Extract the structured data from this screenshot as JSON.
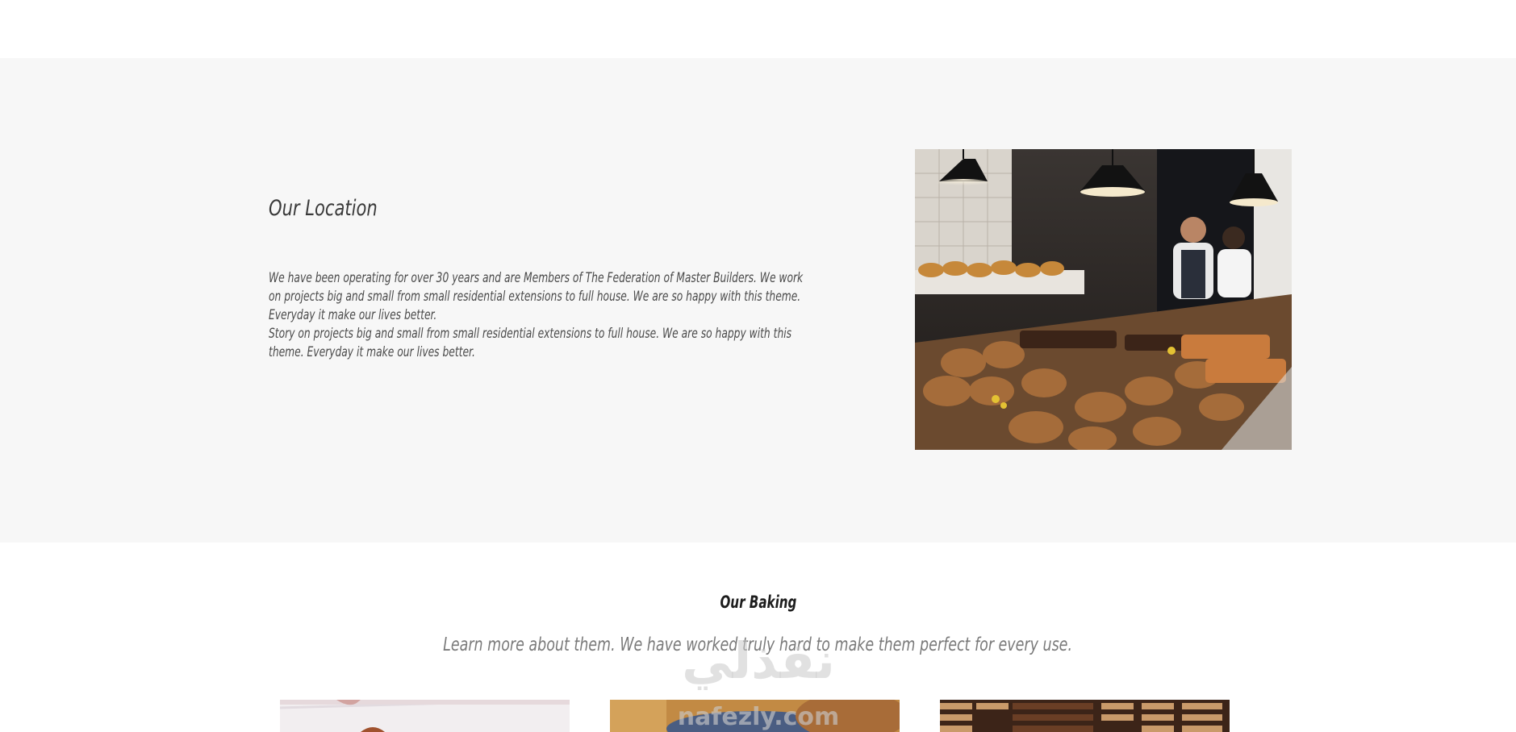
{
  "location": {
    "title": "Our Location",
    "paragraph_1": "We have been operating for over 30 years and are Members of The Federation of Master Builders. We work on projects big and small from small residential extensions to full house. We are so happy with this theme. Everyday it make our lives better.",
    "paragraph_2": "Story on projects big and small from small residential extensions to full house. We are so happy with this theme. Everyday it make our lives better.",
    "image": "bakery-counter-photo"
  },
  "baking": {
    "title": "Our Baking",
    "subtitle": "Learn more about them. We have worked truly hard to make them perfect for every use.",
    "cards": [
      {
        "image": "pastry-marble-photo"
      },
      {
        "image": "bread-basket-photo"
      },
      {
        "image": "cookies-stack-photo"
      }
    ]
  },
  "watermark": {
    "arabic": "نفذلي",
    "latin": "nafezly.com"
  }
}
